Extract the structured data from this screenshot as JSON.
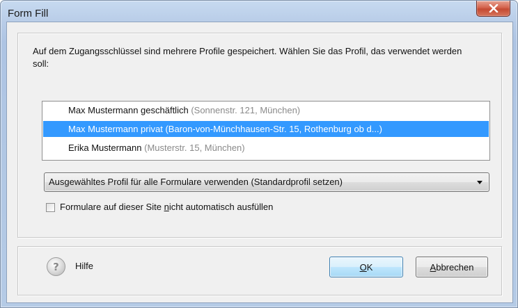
{
  "window": {
    "title": "Form Fill",
    "close_icon": "close-x-icon"
  },
  "dialog": {
    "description": "Auf dem Zugangsschlüssel sind mehrere Profile gespeichert. Wählen Sie das Profil, das verwendet werden soll:",
    "profiles": [
      {
        "name": "Max Mustermann geschäftlich",
        "address": "(Sonnenstr. 121, München)",
        "selected": false
      },
      {
        "name": "Max Mustermann privat",
        "address": "(Baron-von-Münchhausen-Str. 15, Rothenburg ob d...)",
        "selected": true
      },
      {
        "name": "Erika Mustermann",
        "address": "(Musterstr. 15, München)",
        "selected": false
      }
    ],
    "profile_usage_select": {
      "selected": "Ausgewähltes Profil für alle Formulare verwenden (Standardprofil setzen)"
    },
    "autofill_checkbox": {
      "label_before": "Formulare auf dieser Site ",
      "label_mnemonic": "n",
      "label_after": "icht automatisch ausfüllen",
      "checked": false
    }
  },
  "footer": {
    "help_label": "Hilfe",
    "help_icon": "question-mark-icon",
    "ok_mnemonic": "O",
    "ok_rest": "K",
    "cancel_mnemonic": "A",
    "cancel_rest": "bbrechen"
  },
  "colors": {
    "selection": "#3399ff",
    "close_button": "#c44a32",
    "address_gray": "#8a8a8a"
  }
}
